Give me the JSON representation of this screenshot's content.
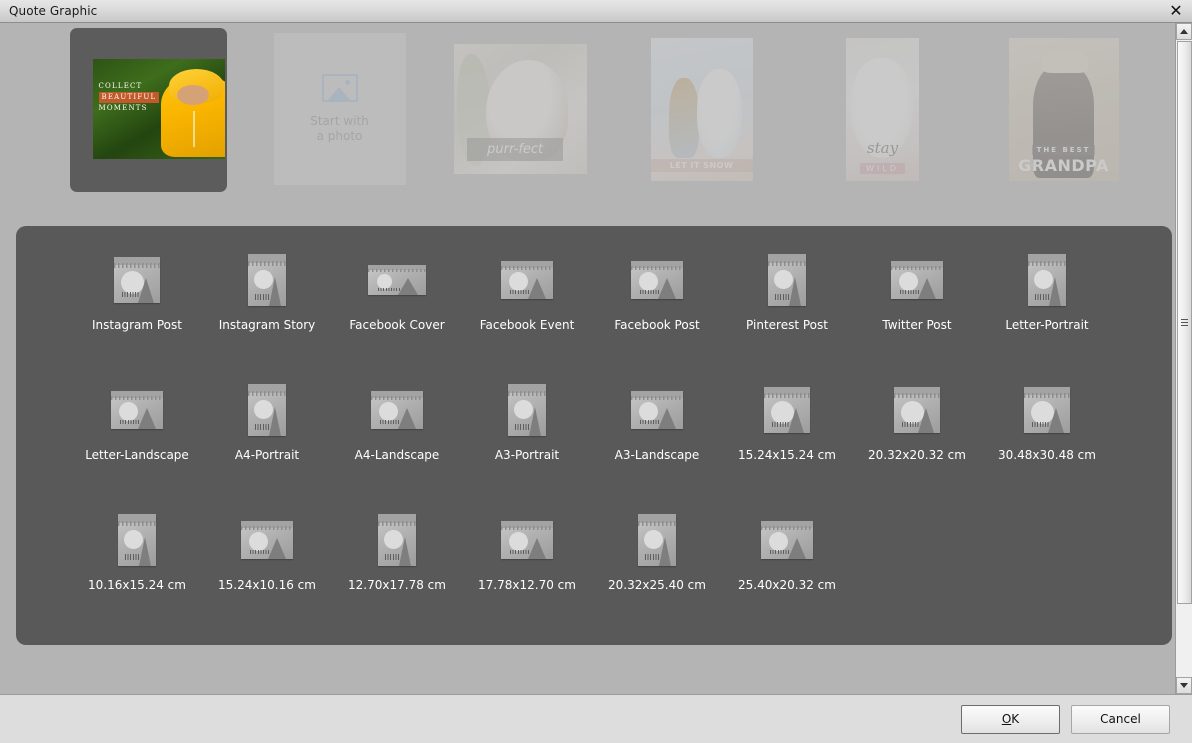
{
  "window": {
    "title": "Quote Graphic",
    "close_icon": "close-icon"
  },
  "templates_strip": {
    "items": [
      {
        "name": "collect-beautiful-moments",
        "kind": "photo",
        "selected": true,
        "overlay_lines": [
          "COLLECT",
          "BEAUTIFUL",
          "MOMENTS"
        ]
      },
      {
        "name": "start-with-a-photo",
        "kind": "placeholder",
        "selected": false,
        "icon": "image-placeholder-icon",
        "line1": "Start with",
        "line2": "a photo"
      },
      {
        "name": "purr-fect",
        "kind": "photo",
        "selected": false,
        "caption": "purr-fect"
      },
      {
        "name": "let-it-snow",
        "kind": "photo",
        "selected": false,
        "caption": "LET IT SNOW"
      },
      {
        "name": "stay-wild",
        "kind": "photo",
        "selected": false,
        "caption_script": "stay",
        "caption_block": "WILD"
      },
      {
        "name": "the-best-grandpa",
        "kind": "photo",
        "selected": false,
        "caption_small": "THE BEST",
        "caption_big": "GRANDPA"
      }
    ]
  },
  "size_panel": {
    "icon_name": "landscape-thumbnail-icon",
    "rows": [
      [
        {
          "label": "Instagram Post",
          "shape": "square"
        },
        {
          "label": "Instagram Story",
          "shape": "portrait"
        },
        {
          "label": "Facebook Cover",
          "shape": "wide"
        },
        {
          "label": "Facebook Event",
          "shape": "landscape"
        },
        {
          "label": "Facebook Post",
          "shape": "landscape"
        },
        {
          "label": "Pinterest Post",
          "shape": "portrait"
        },
        {
          "label": "Twitter Post",
          "shape": "landscape"
        },
        {
          "label": "Letter-Portrait",
          "shape": "portrait"
        }
      ],
      [
        {
          "label": "Letter-Landscape",
          "shape": "landscape"
        },
        {
          "label": "A4-Portrait",
          "shape": "portrait"
        },
        {
          "label": "A4-Landscape",
          "shape": "landscape"
        },
        {
          "label": "A3-Portrait",
          "shape": "portrait"
        },
        {
          "label": "A3-Landscape",
          "shape": "landscape"
        },
        {
          "label": "15.24x15.24 cm",
          "shape": "square"
        },
        {
          "label": "20.32x20.32 cm",
          "shape": "square"
        },
        {
          "label": "30.48x30.48 cm",
          "shape": "square"
        }
      ],
      [
        {
          "label": "10.16x15.24 cm",
          "shape": "portrait"
        },
        {
          "label": "15.24x10.16 cm",
          "shape": "landscape"
        },
        {
          "label": "12.70x17.78 cm",
          "shape": "portrait"
        },
        {
          "label": "17.78x12.70 cm",
          "shape": "landscape"
        },
        {
          "label": "20.32x25.40 cm",
          "shape": "portrait"
        },
        {
          "label": "25.40x20.32 cm",
          "shape": "landscape"
        }
      ]
    ]
  },
  "footer": {
    "ok_accel": "O",
    "ok_rest": "K",
    "cancel_label": "Cancel"
  },
  "scrollbar": {
    "up_icon": "chevron-up-icon",
    "down_icon": "chevron-down-icon"
  },
  "colors": {
    "panel_bg": "#595959",
    "window_bg": "#b4b4b4",
    "selected_tile": "#5c5c5c",
    "label_text": "#ffffff"
  }
}
